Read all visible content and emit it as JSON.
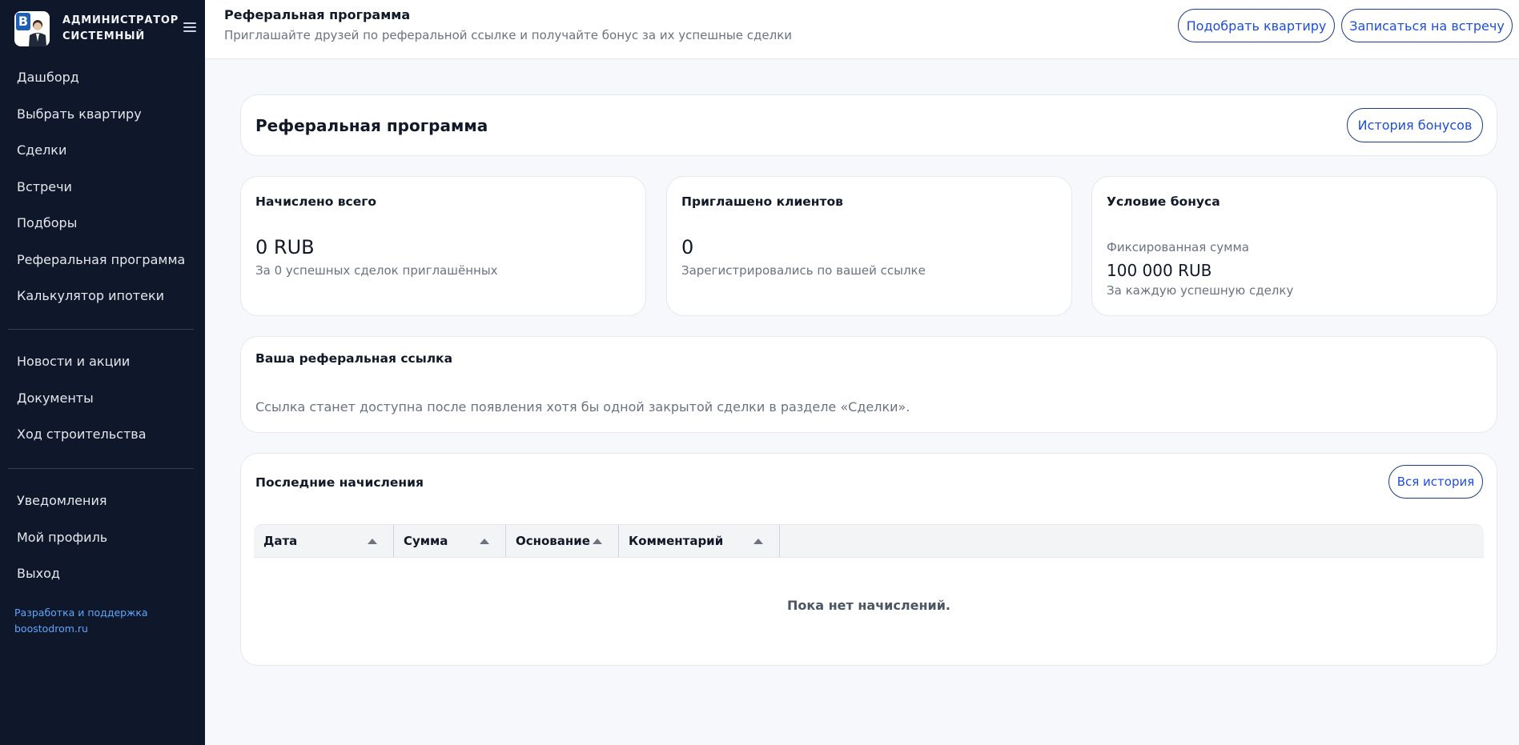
{
  "brand": {
    "name": "АДМИНИСТРАТОР СИСТЕМНЫЙ",
    "logo_letter": "B"
  },
  "sidebar": {
    "group1": [
      "Дашборд",
      "Выбрать квартиру",
      "Сделки",
      "Встречи",
      "Подборы",
      "Реферальная программа",
      "Калькулятор ипотеки"
    ],
    "group2": [
      "Новости и акции",
      "Документы",
      "Ход строительства"
    ],
    "group3": [
      "Уведомления",
      "Мой профиль",
      "Выход"
    ],
    "credits_line1": "Разработка и поддержка",
    "credits_line2": "boostodrom.ru"
  },
  "header": {
    "title": "Реферальная программа",
    "subtitle": "Приглашайте друзей по реферальной ссылке и получайте бонус за их успешные сделки",
    "btn_pick": "Подобрать квартиру",
    "btn_meeting": "Записаться на встречу"
  },
  "main": {
    "title": "Реферальная программа",
    "history_button": "История бонусов",
    "stats": {
      "accrued": {
        "title": "Начислено всего",
        "value": "0 RUB",
        "note": "За 0 успешных сделок приглашённых"
      },
      "invited": {
        "title": "Приглашено клиентов",
        "value": "0",
        "note": "Зарегистрировались по вашей ссылке"
      },
      "condition": {
        "title": "Условие бонуса",
        "label": "Фиксированная сумма",
        "value": "100 000 RUB",
        "note": "За каждую успешную сделку"
      }
    },
    "link": {
      "title": "Ваша реферальная ссылка",
      "text": "Ссылка станет доступна после появления хотя бы одной закрытой сделки в разделе «Сделки»."
    },
    "recent": {
      "title": "Последние начисления",
      "all_history": "Вся история",
      "columns": [
        "Дата",
        "Сумма",
        "Основание",
        "Комментарий"
      ],
      "empty": "Пока нет начислений."
    }
  }
}
